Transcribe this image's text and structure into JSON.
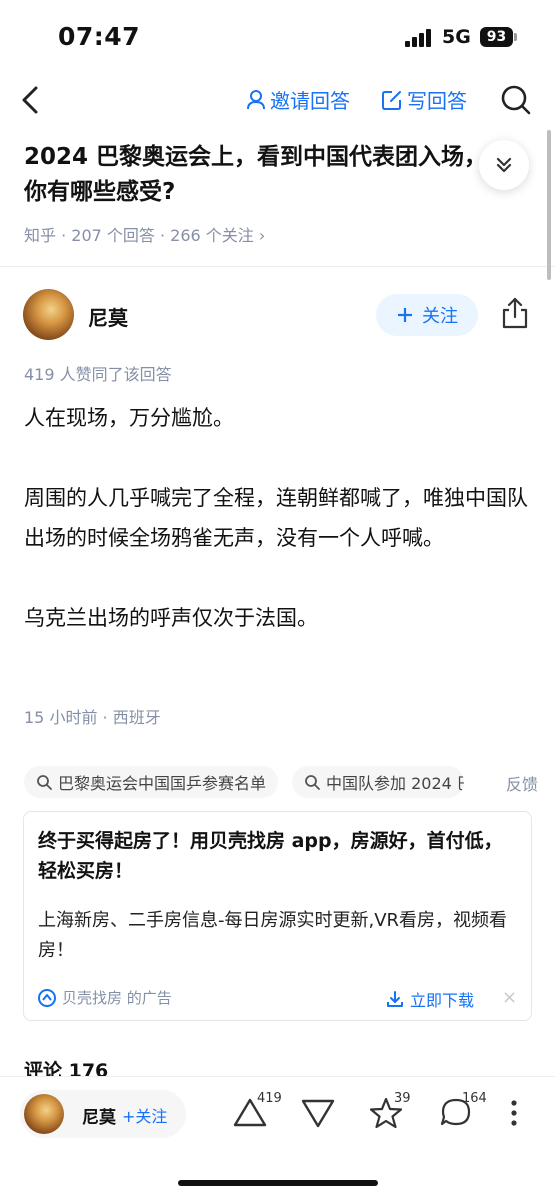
{
  "status_bar": {
    "time": "07:47",
    "network": "5G",
    "battery": "93"
  },
  "nav": {
    "invite_label": "邀请回答",
    "write_label": "写回答"
  },
  "question": {
    "title": "2024 巴黎奥运会上，看到中国代表团入场，你有哪些感受?",
    "meta": "知乎 · 207 个回答 · 266 个关注 ›"
  },
  "author": {
    "name": "尼莫",
    "follow_label": "关注",
    "vote_line": "419 人赞同了该回答"
  },
  "answer": {
    "paragraphs": [
      "人在现场，万分尴尬。",
      "周围的人几乎喊完了全程，连朝鲜都喊了，唯独中国队出场的时候全场鸦雀无声，没有一个人呼喊。",
      "乌克兰出场的呼声仅次于法国。"
    ],
    "time": "15 小时前 · 西班牙"
  },
  "related": {
    "chips": [
      "巴黎奥运会中国国乒参赛名单",
      "中国队参加 2024 巴"
    ],
    "feedback": "反馈"
  },
  "ad": {
    "title": "终于买得起房了！用贝壳找房 app，房源好，首付低，轻松买房！",
    "desc": "上海新房、二手房信息-每日房源实时更新,VR看房，视频看房！",
    "source": "贝壳找房 的广告",
    "download": "立即下载",
    "close": "×"
  },
  "comments_label": "评论 176",
  "bottom_bar": {
    "author_name": "尼莫",
    "follow_label": "+关注",
    "upvote_count": "419",
    "favorite_count": "39",
    "comment_count": "164"
  },
  "colors": {
    "accent": "#1772f6",
    "meta": "#8590a6"
  }
}
